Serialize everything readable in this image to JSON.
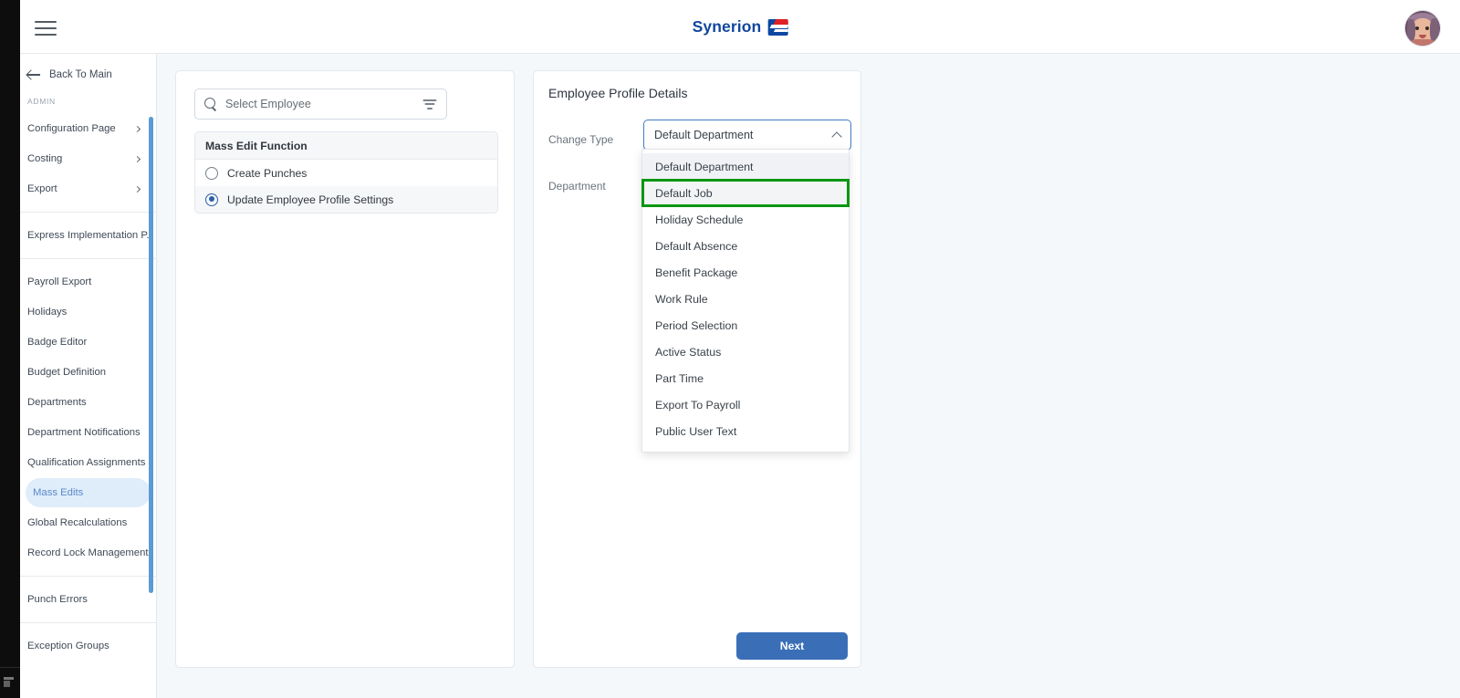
{
  "app": {
    "brand_name": "Synerion",
    "brand_color": "#12479e",
    "accent_color": "#3a6fb8",
    "highlight_color": "#0a9612"
  },
  "header": {
    "menu_icon": "hamburger-menu-icon",
    "avatar_icon": "user-avatar"
  },
  "sidebar": {
    "back_label": "Back To Main",
    "back_icon": "arrow-left-icon",
    "section_title": "ADMIN",
    "groups": [
      {
        "items": [
          {
            "label": "Configuration Page",
            "expandable": true
          },
          {
            "label": "Costing",
            "expandable": true
          },
          {
            "label": "Export",
            "expandable": true
          }
        ]
      },
      {
        "items": [
          {
            "label": "Express Implementation P...",
            "expandable": false
          }
        ]
      },
      {
        "items": [
          {
            "label": "Payroll Export",
            "expandable": false
          },
          {
            "label": "Holidays",
            "expandable": false
          },
          {
            "label": "Badge Editor",
            "expandable": false
          },
          {
            "label": "Budget Definition",
            "expandable": false
          },
          {
            "label": "Departments",
            "expandable": false
          },
          {
            "label": "Department Notifications",
            "expandable": false
          },
          {
            "label": "Qualification Assignments",
            "expandable": false
          },
          {
            "label": "Mass Edits",
            "expandable": false,
            "active": true
          },
          {
            "label": "Global Recalculations",
            "expandable": false
          },
          {
            "label": "Record Lock Management",
            "expandable": false
          }
        ]
      },
      {
        "items": [
          {
            "label": "Punch Errors",
            "expandable": false
          }
        ]
      },
      {
        "items": [
          {
            "label": "Exception Groups",
            "expandable": false
          }
        ]
      }
    ]
  },
  "left_panel": {
    "search": {
      "placeholder": "Select Employee",
      "icon": "search-icon",
      "filter_icon": "filter-icon"
    },
    "mass_edit": {
      "header": "Mass Edit Function",
      "options": [
        {
          "label": "Create Punches",
          "selected": false
        },
        {
          "label": "Update Employee Profile Settings",
          "selected": true
        }
      ]
    }
  },
  "right_panel": {
    "title": "Employee Profile Details",
    "fields": [
      {
        "label": "Change Type"
      },
      {
        "label": "Department"
      }
    ],
    "change_type_select": {
      "value": "Default Department",
      "expanded": true,
      "chevron_icon": "chevron-up-icon",
      "options": [
        {
          "label": "Default Department",
          "state": "selected"
        },
        {
          "label": "Default Job",
          "state": "highlight"
        },
        {
          "label": "Holiday Schedule",
          "state": "normal"
        },
        {
          "label": "Default Absence",
          "state": "normal"
        },
        {
          "label": "Benefit Package",
          "state": "normal"
        },
        {
          "label": "Work Rule",
          "state": "normal"
        },
        {
          "label": "Period Selection",
          "state": "normal"
        },
        {
          "label": "Active Status",
          "state": "normal"
        },
        {
          "label": "Part Time",
          "state": "normal"
        },
        {
          "label": "Export To Payroll",
          "state": "normal"
        },
        {
          "label": "Public User Text",
          "state": "normal"
        }
      ]
    },
    "next_label": "Next"
  }
}
